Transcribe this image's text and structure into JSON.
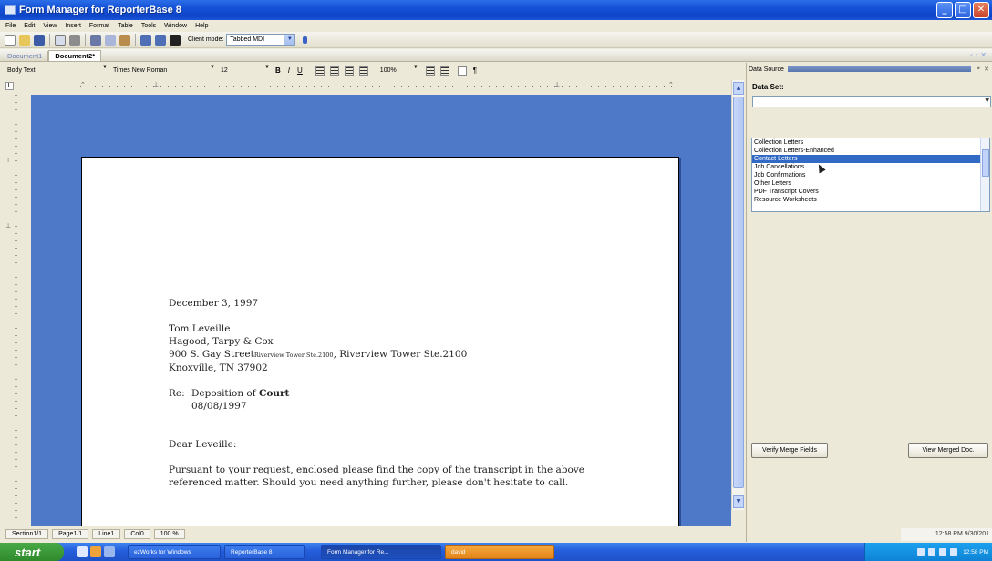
{
  "window": {
    "title": "Form Manager for ReporterBase 8"
  },
  "menu": [
    "File",
    "Edit",
    "View",
    "Insert",
    "Format",
    "Table",
    "Tools",
    "Window",
    "Help"
  ],
  "toolbar": {
    "client_mode_label": "Client mode:",
    "client_mode_value": "Tabbed MDI"
  },
  "tabs": [
    {
      "label": "Document1"
    },
    {
      "label": "Document2*"
    }
  ],
  "formatting": {
    "style": "Body Text",
    "font": "Times New Roman",
    "size": "12",
    "zoom": "100%"
  },
  "letter": {
    "date": "December 3, 1997",
    "recipient_name": "Tom Leveille",
    "recipient_firm": "Hagood, Tarpy & Cox",
    "address_line": "900 S. Gay Street",
    "address_inline_small": "Riverview Tower Ste.2100",
    "address_suffix": ", Riverview Tower Ste.2100",
    "city_line": "Knoxville, TN  37902",
    "re_label": "Re:",
    "re_prefix": "Deposition of ",
    "re_bold": "Court",
    "re_date": "08/08/1997",
    "salutation": "Dear Leveille:",
    "body_line1": "Pursuant to your request, enclosed please find the copy of the transcript in the above",
    "body_line2": "referenced matter.  Should you need anything further, please don't hesitate to call."
  },
  "statusbar": {
    "section": "Section1/1",
    "page": "Page1/1",
    "line": "Line1",
    "col": "Col0",
    "zoom": "100 %"
  },
  "panel": {
    "title": "Data Source",
    "dataset_label": "Data Set:",
    "dataset_items": [
      "Collection Letters",
      "Collection Letters-Enhanced",
      "Contact Letters",
      "Job Cancellations",
      "Job Confirmations",
      "Other Letters",
      "PDF Transcript Covers",
      "Resource Worksheets"
    ],
    "selected_index": 2,
    "verify_button": "Verify Merge Fields",
    "view_button": "View Merged Doc."
  },
  "taskbar": {
    "start": "start",
    "tasks": [
      "ezWorks for Windows",
      "ReporterBase 8",
      "Form Manager for Re...",
      "david"
    ],
    "clock": "12:58 PM",
    "clock_popup": "12:58 PM  9/30/201"
  }
}
